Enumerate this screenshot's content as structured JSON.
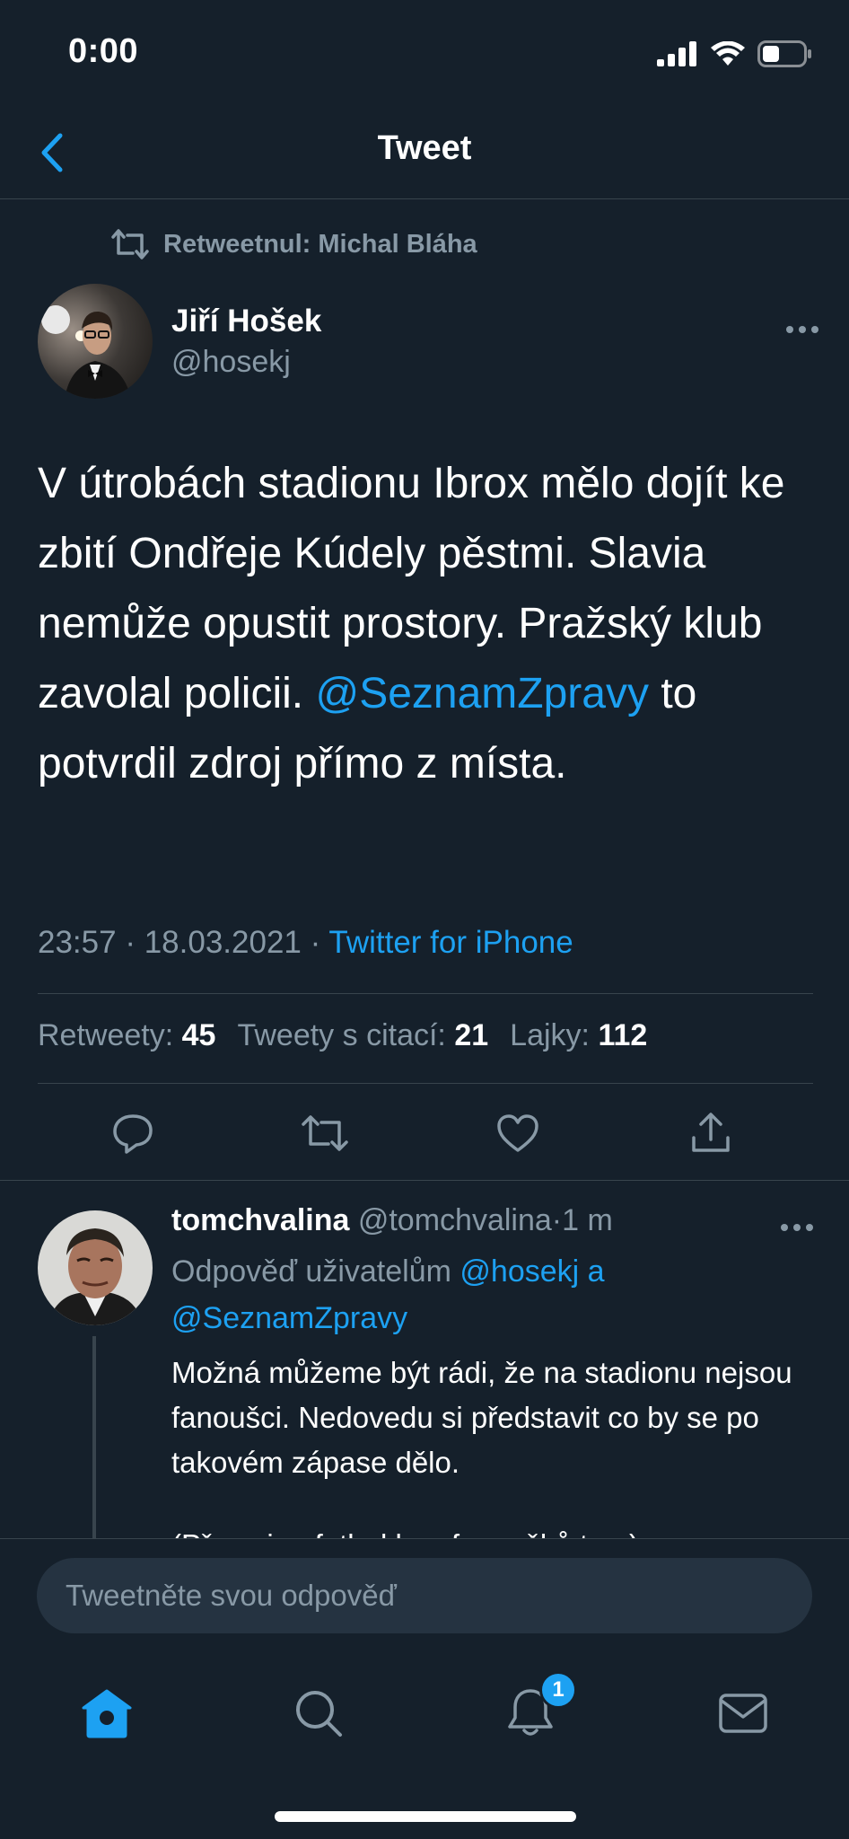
{
  "status_bar": {
    "time": "0:00"
  },
  "header": {
    "title": "Tweet",
    "back_icon": "chevron-left-icon"
  },
  "retweet_context": {
    "text": "Retweetnul: Michal Bláha",
    "icon": "retweet-icon"
  },
  "tweet": {
    "author_name": "Jiří Hošek",
    "author_handle": "@hosekj",
    "text_before": "V útrobách stadionu Ibrox mělo dojít ke zbití Ondřeje Kúdely pěstmi. Slavia nemůže opustit prostory. Pražský klub zavolal policii. ",
    "mention": "@SeznamZpravy",
    "text_after": " to potvrdil zdroj přímo z místa.",
    "time": "23:57",
    "date": "18.03.2021",
    "source": "Twitter for iPhone",
    "separator": "·",
    "stats": {
      "retweets_label": "Retweety:",
      "retweets": "45",
      "quotes_label": "Tweety s citací:",
      "quotes": "21",
      "likes_label": "Lajky:",
      "likes": "112"
    }
  },
  "reply": {
    "name": "tomchvalina",
    "handle": "@tomchvalina",
    "separator": "·",
    "age": "1 m",
    "reply_to_label": "Odpověď uživatelům",
    "reply_to_user1": "@hosekj",
    "reply_to_joiner": "a",
    "reply_to_user2": "@SeznamZpravy",
    "text": "Možná můžeme být rádi, že na stadionu nejsou fanoušci. Nedovedu si představit co by se po takovém zápase dělo.",
    "text_cut": "(Přece jen fotbal bez fanoušků to...)"
  },
  "compose": {
    "placeholder": "Tweetněte svou odpověď"
  },
  "tabbar": {
    "notifications_badge": "1"
  },
  "colors": {
    "background": "#15202b",
    "accent": "#1da1f2",
    "muted": "#8899a6",
    "divider": "#38444d"
  }
}
